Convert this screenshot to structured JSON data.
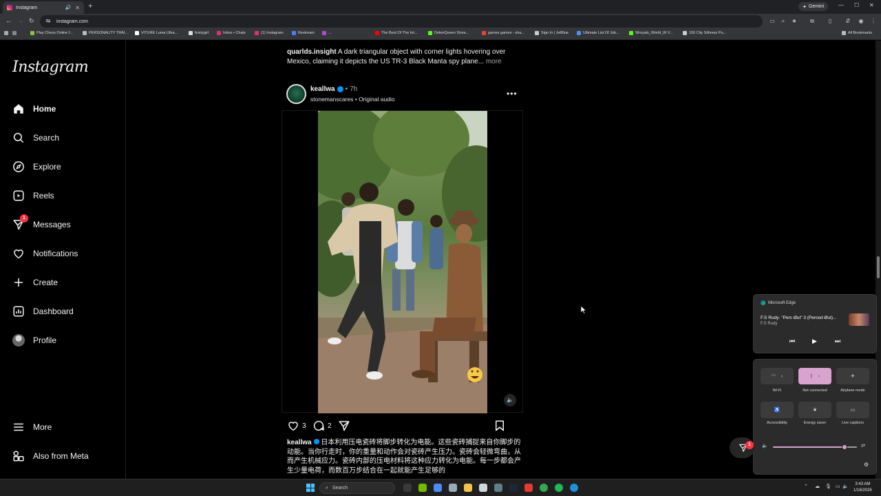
{
  "browser": {
    "tab_title": "Instagram",
    "new_tab_symbol": "+",
    "url": "instagram.com",
    "gemini_label": "Gemini",
    "bookmarks": [
      {
        "label": "Play Chess Online f...",
        "color": "#8bc34a"
      },
      {
        "label": "PERSONALITY TRAI...",
        "color": "#bbbbbb"
      },
      {
        "label": "VITURE Luma Ultra...",
        "color": "#ffffff"
      },
      {
        "label": "feistygirl",
        "color": "#dddddd"
      },
      {
        "label": "Inbox • Chats",
        "color": "#e1306c"
      },
      {
        "label": "(1) Instagram",
        "color": "#e1306c"
      },
      {
        "label": "Restream",
        "color": "#4a7cff"
      },
      {
        "label": "...",
        "color": "#b04ad0"
      },
      {
        "label": "The Best Of The Int...",
        "color": "#ff0000"
      },
      {
        "label": "DelenQueen Strea...",
        "color": "#53fc18"
      },
      {
        "label": "games games - sha...",
        "color": "#e8403a"
      },
      {
        "label": "Sign In | JetBlue",
        "color": "#cccccc"
      },
      {
        "label": "Ultimate List Of Job...",
        "color": "#4f8ef7"
      },
      {
        "label": "Wroyals_World_W V...",
        "color": "#53fc18"
      },
      {
        "label": "150 City Silhresz Pu...",
        "color": "#cccccc"
      }
    ],
    "all_bookmarks_label": "All Bookmarks"
  },
  "sidebar": {
    "logo": "Instagram",
    "items": [
      {
        "label": "Home",
        "icon": "home-icon"
      },
      {
        "label": "Search",
        "icon": "search-icon"
      },
      {
        "label": "Explore",
        "icon": "compass-icon"
      },
      {
        "label": "Reels",
        "icon": "reels-icon"
      },
      {
        "label": "Messages",
        "icon": "messenger-icon",
        "badge": "1"
      },
      {
        "label": "Notifications",
        "icon": "heart-icon"
      },
      {
        "label": "Create",
        "icon": "plus-icon"
      },
      {
        "label": "Dashboard",
        "icon": "dashboard-icon"
      },
      {
        "label": "Profile",
        "icon": "avatar"
      }
    ],
    "more_label": "More",
    "meta_label": "Also from Meta"
  },
  "feed": {
    "prev_caption": {
      "user": "quarlds.insight",
      "text": " A dark triangular object with corner lights hovering over Mexico, claiming it depicts the US TR-3 Black Manta spy plane...",
      "more": " more"
    },
    "post": {
      "username": "keallwa",
      "time": "7h",
      "subtitle": "stonemanscares • Original audio",
      "likes": "3",
      "comments": "2",
      "caption_user": "keallwa",
      "caption_text": " 日本利用压电瓷砖将脚步转化为电能。这些瓷砖捕捉来自你脚步的动能。当你行走时，你的重量和动作会对瓷砖产生压力。瓷砖会轻微弯曲，从而产生机械应力。瓷砖内部的压电材料将这种应力转化为电能。每一步都会产生少量电荷，而数百万步结合在一起就能产生足够的"
    }
  },
  "media_flyout": {
    "source": "Microsoft Edge",
    "title": "F.S Rudy- \"Perc Øut\" 3 (Perced Øut)...",
    "artist": "F.S Rudy"
  },
  "quick_settings": {
    "wifi_label": "Wi-Fi",
    "bt_label": "Not connected",
    "airplane_label": "Airplane mode",
    "access_label": "Accessibility",
    "energy_label": "Energy saver",
    "captions_label": "Live captions",
    "volume_level": 0.85
  },
  "float_badge": "1",
  "taskbar": {
    "search_placeholder": "Search",
    "time": "3:43 AM",
    "date": "1/16/2026"
  },
  "colors": {
    "accent_pink": "#d8a3cf",
    "badge_red": "#ff3040",
    "verified_blue": "#0095f6"
  }
}
